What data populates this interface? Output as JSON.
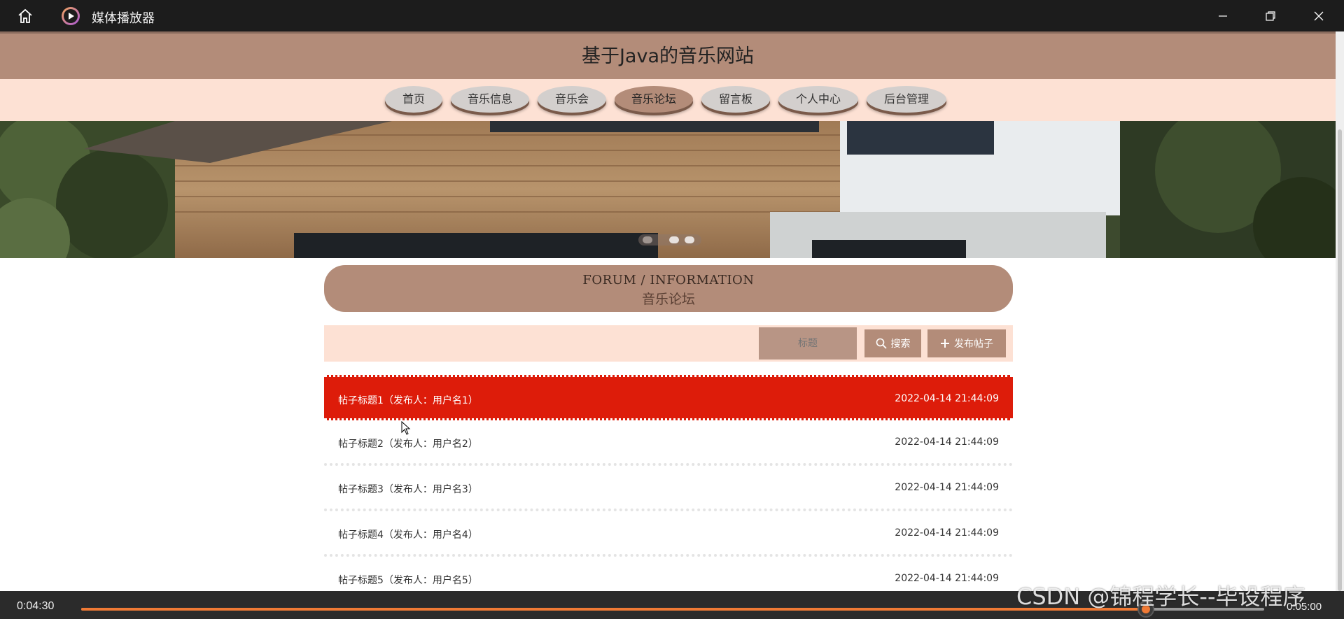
{
  "player": {
    "app_title": "媒体播放器",
    "current_time": "0:04:30",
    "total_time": "0:05:00",
    "progress": 0.9,
    "watermark": "CSDN @锦程学长--毕设程序"
  },
  "site": {
    "title": "基于Java的音乐网站",
    "nav": [
      {
        "label": "首页"
      },
      {
        "label": "音乐信息"
      },
      {
        "label": "音乐会"
      },
      {
        "label": "音乐论坛",
        "active": true
      },
      {
        "label": "留言板"
      },
      {
        "label": "个人中心"
      },
      {
        "label": "后台管理"
      }
    ]
  },
  "forum": {
    "heading_en": "FORUM / INFORMATION",
    "heading_cn": "音乐论坛",
    "search_placeholder": "标题",
    "search_label": "搜索",
    "post_label": "发布帖子",
    "posts": [
      {
        "title": "帖子标题1（发布人：用户名1）",
        "time": "2022-04-14 21:44:09"
      },
      {
        "title": "帖子标题2（发布人：用户名2）",
        "time": "2022-04-14 21:44:09"
      },
      {
        "title": "帖子标题3（发布人：用户名3）",
        "time": "2022-04-14 21:44:09"
      },
      {
        "title": "帖子标题4（发布人：用户名4）",
        "time": "2022-04-14 21:44:09"
      },
      {
        "title": "帖子标题5（发布人：用户名5）",
        "time": "2022-04-14 21:44:09"
      }
    ]
  },
  "colors": {
    "accent_brown": "#b38c79",
    "nav_bg": "#fde1d4",
    "highlight_red": "#dd1c0a",
    "progress_orange": "#f07a35"
  }
}
